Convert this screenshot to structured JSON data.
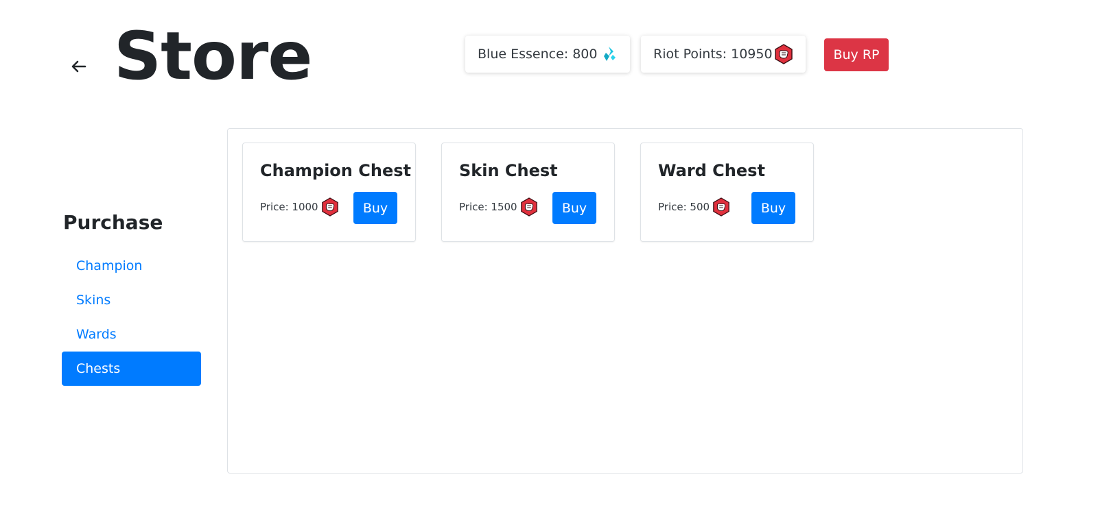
{
  "header": {
    "title": "Store",
    "back_icon": "arrow-left-icon"
  },
  "currencies": {
    "blue_essence": {
      "label": "Blue Essence: 800",
      "icon": "blue-essence-icon",
      "color": "#20c5e0"
    },
    "riot_points": {
      "label": "Riot Points: 10950",
      "icon": "riot-points-icon",
      "color": "#e0303d"
    },
    "buy_rp_label": "Buy RP"
  },
  "sidebar": {
    "heading": "Purchase",
    "items": [
      {
        "label": "Champion",
        "active": false
      },
      {
        "label": "Skins",
        "active": false
      },
      {
        "label": "Wards",
        "active": false
      },
      {
        "label": "Chests",
        "active": true
      }
    ]
  },
  "chests": [
    {
      "name": "Champion Chest",
      "price_label": "Price: 1000",
      "buy_label": "Buy"
    },
    {
      "name": "Skin Chest",
      "price_label": "Price: 1500",
      "buy_label": "Buy"
    },
    {
      "name": "Ward Chest",
      "price_label": "Price: 500",
      "buy_label": "Buy"
    }
  ],
  "colors": {
    "primary": "#007bff",
    "danger": "#dc3545",
    "text": "#212529"
  }
}
